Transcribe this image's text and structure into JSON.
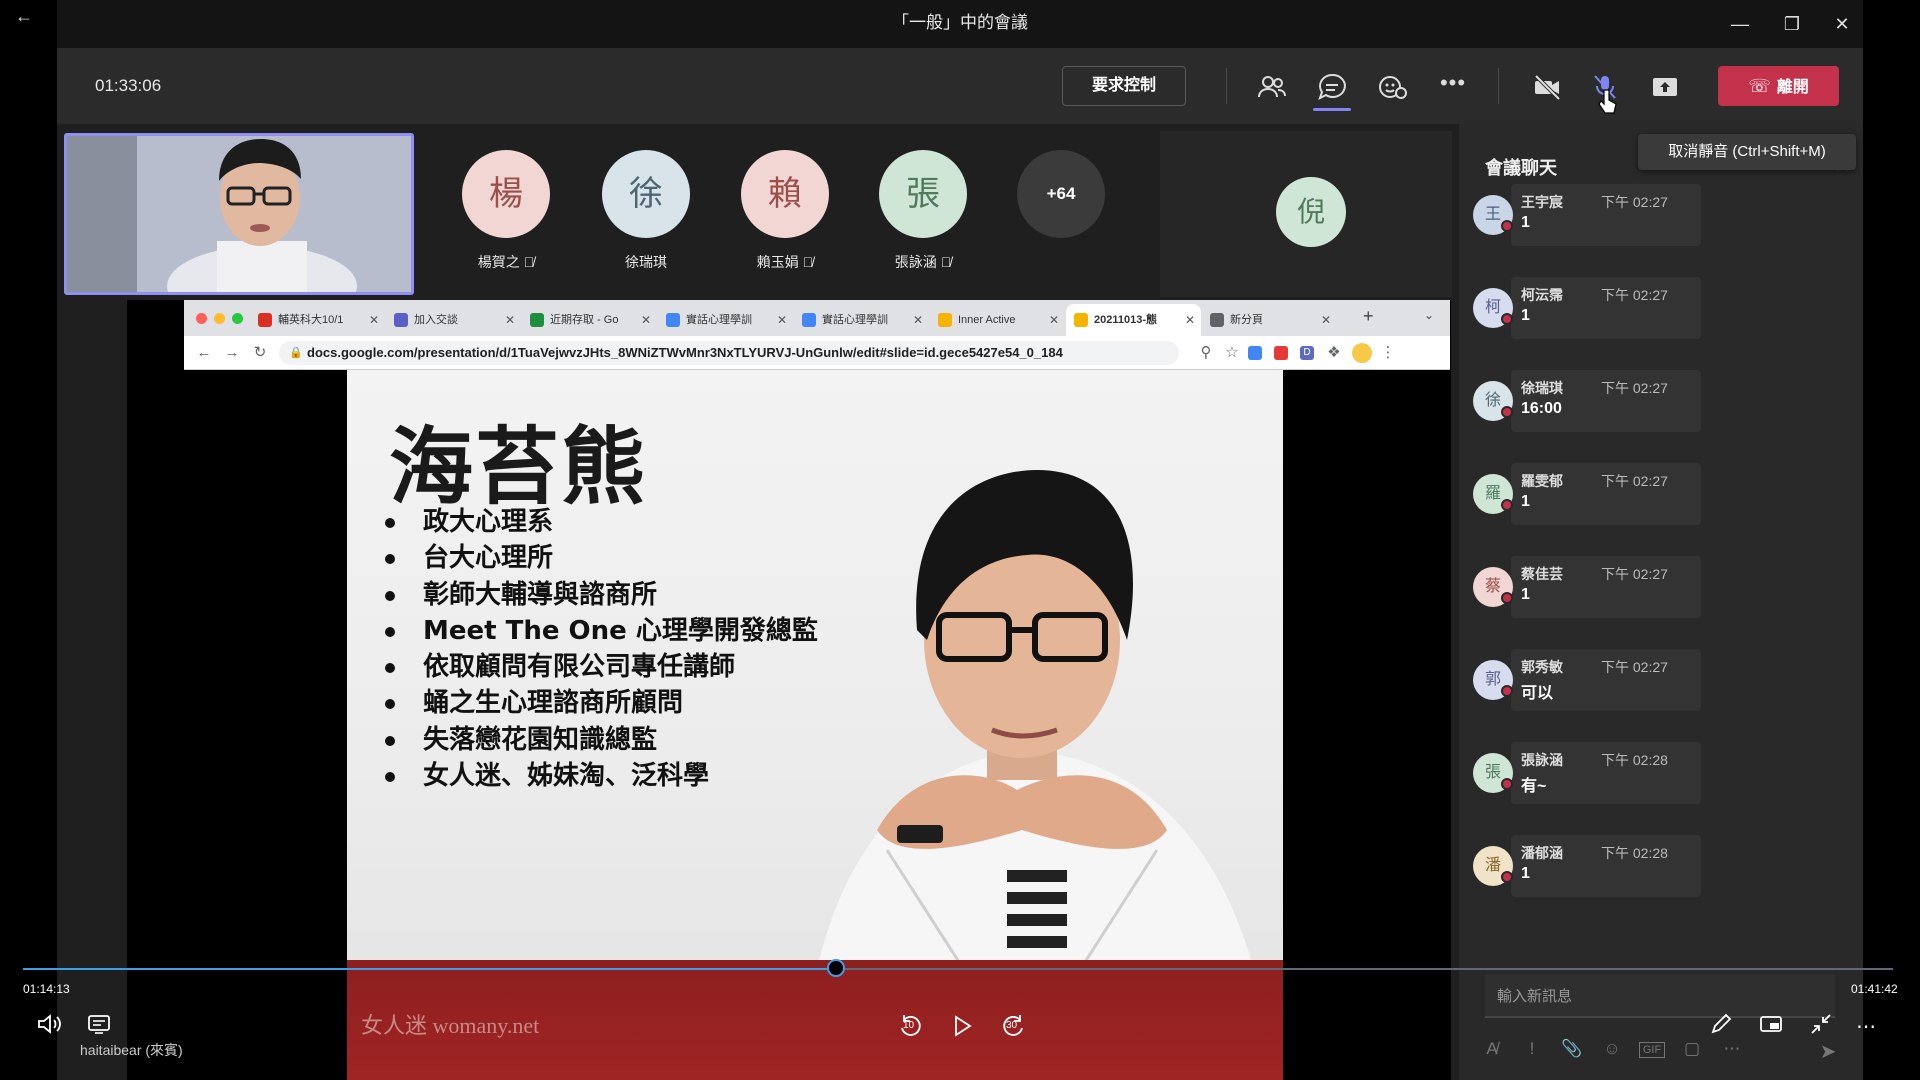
{
  "window": {
    "title": "「一般」中的會議"
  },
  "meeting": {
    "elapsed": "01:33:06",
    "request_control_label": "要求控制",
    "leave_label": "離開",
    "mute_tooltip": "取消靜音 (Ctrl+Shift+M)"
  },
  "participants": [
    {
      "initial": "楊",
      "name": "楊賀之",
      "muted": true,
      "bg": "#f2d6d4",
      "fg": "#9b4f49"
    },
    {
      "initial": "徐",
      "name": "徐瑞琪",
      "muted": false,
      "bg": "#d8e4ea",
      "fg": "#4d6673"
    },
    {
      "initial": "賴",
      "name": "賴玉娟",
      "muted": true,
      "bg": "#f2d6d4",
      "fg": "#9b4f49"
    },
    {
      "initial": "張",
      "name": "張詠涵",
      "muted": true,
      "bg": "#cfe6d6",
      "fg": "#4f7a5c"
    }
  ],
  "more_participants": "+64",
  "spotlight": {
    "initial": "倪"
  },
  "browser": {
    "tabs": [
      {
        "label": "輔英科大10/1",
        "color": "#d93025"
      },
      {
        "label": "加入交談",
        "color": "#5b5fc7"
      },
      {
        "label": "近期存取 - Go",
        "color": "#1e8e3e"
      },
      {
        "label": "實話心理學訓",
        "color": "#4285f4"
      },
      {
        "label": "實話心理學訓",
        "color": "#4285f4"
      },
      {
        "label": "Inner Active",
        "color": "#f4b400"
      },
      {
        "label": "20211013-態",
        "color": "#f4b400",
        "active": true
      },
      {
        "label": "新分頁",
        "color": "#5f6368"
      }
    ],
    "url": "docs.google.com/presentation/d/1TuaVejwvzJHts_8WNiZTWvMnr3NxTLYURVJ-UnGunlw/edit#slide=id.gece5427e54_0_184"
  },
  "slide": {
    "title": "海苔熊",
    "bullets": [
      "政大心理系",
      "台大心理所",
      "彰師大輔導與諮商所",
      "Meet The One 心理學開發總監",
      "依取顧問有限公司專任講師",
      "蛹之生心理諮商所顧問",
      "失落戀花園知識總監",
      "女人迷、姊妹淘、泛科學"
    ],
    "watermark": "女人迷 womany.net"
  },
  "chat": {
    "title": "會議聊天",
    "compose_placeholder": "輸入新訊息",
    "messages": [
      {
        "name": "王宇宸",
        "time": "下午 02:27",
        "text": "1",
        "initial": "王",
        "bg": "#c9d6e8",
        "fg": "#4a5f7e",
        "photo": true
      },
      {
        "name": "柯沄霈",
        "time": "下午 02:27",
        "text": "1",
        "initial": "柯",
        "bg": "#d8dcef",
        "fg": "#5a6090"
      },
      {
        "name": "徐瑞琪",
        "time": "下午 02:27",
        "text": "16:00",
        "initial": "徐",
        "bg": "#d8e4ea",
        "fg": "#4d6673"
      },
      {
        "name": "羅雯郁",
        "time": "下午 02:27",
        "text": "1",
        "initial": "羅",
        "bg": "#cfe6d6",
        "fg": "#4f7a5c"
      },
      {
        "name": "蔡佳芸",
        "time": "下午 02:27",
        "text": "1",
        "initial": "蔡",
        "bg": "#f2d6d4",
        "fg": "#9b4f49"
      },
      {
        "name": "郭秀敏",
        "time": "下午 02:27",
        "text": "可以",
        "initial": "郭",
        "bg": "#d8dcef",
        "fg": "#5a6090"
      },
      {
        "name": "張詠涵",
        "time": "下午 02:28",
        "text": "有~",
        "initial": "張",
        "bg": "#cfe6d6",
        "fg": "#4f7a5c"
      },
      {
        "name": "潘郁涵",
        "time": "下午 02:28",
        "text": "1",
        "initial": "潘",
        "bg": "#f1e3c7",
        "fg": "#8a6a2e"
      }
    ]
  },
  "player": {
    "current_time": "01:14:13",
    "total_time": "01:41:42",
    "progress": 0.4345,
    "uploader": "haitaibear (來賓)",
    "skip_back": "10",
    "skip_forward": "30"
  },
  "colors": {
    "accent": "#7f85f5",
    "leave": "#c4314b",
    "progress": "#3e9ee8"
  }
}
